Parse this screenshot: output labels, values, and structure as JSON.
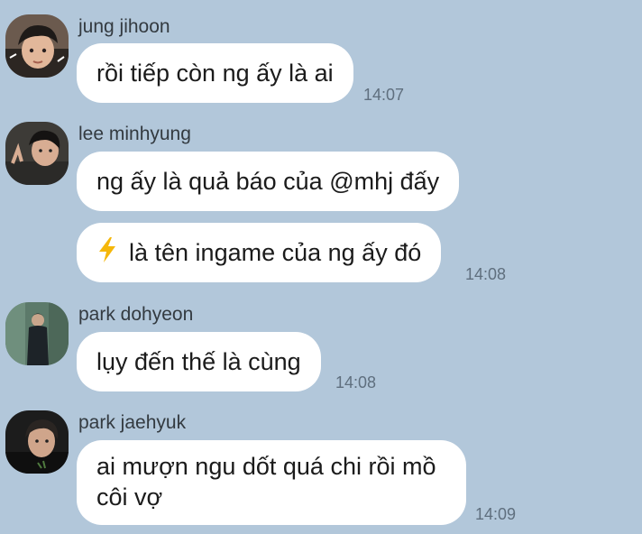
{
  "colors": {
    "background": "#b2c7da",
    "bubble": "#ffffff",
    "bolt": "#f5b70a"
  },
  "messages": [
    {
      "sender": "jung jihoon",
      "bubbles": [
        "rồi tiếp còn ng ấy là ai"
      ],
      "time": "14:07"
    },
    {
      "sender": "lee minhyung",
      "bubbles": [
        "ng ấy là quả báo của @mhj đấy",
        "là tên ingame của ng ấy đó"
      ],
      "bubble2_icon": "lightning-bolt-emoji",
      "time": "14:08"
    },
    {
      "sender": "park dohyeon",
      "bubbles": [
        "lụy đến thế là cùng"
      ],
      "time": "14:08"
    },
    {
      "sender": "park jaehyuk",
      "bubbles": [
        "ai mượn ngu dốt quá chi rồi mồ côi vợ"
      ],
      "time": "14:09"
    }
  ]
}
